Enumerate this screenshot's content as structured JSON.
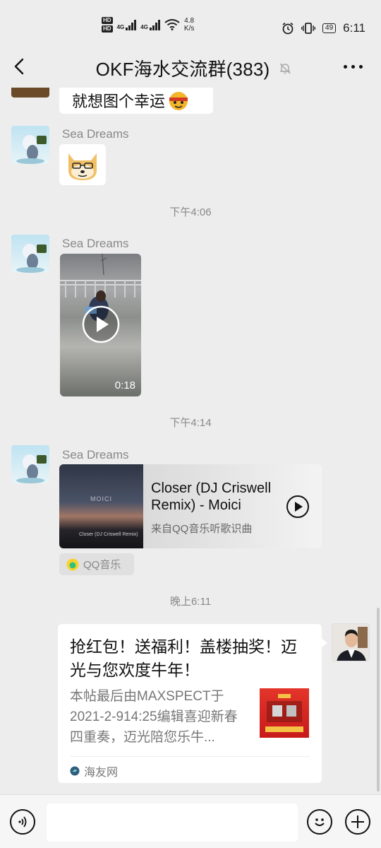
{
  "status_bar": {
    "hd1": "HD",
    "hd2": "HD",
    "net1": "4G",
    "net2": "4G",
    "speed_value": "4.8",
    "speed_unit": "K/s",
    "battery": "49",
    "time": "6:11"
  },
  "nav": {
    "title": "OKF海水交流群(383)"
  },
  "messages": {
    "partial_text": "就想图个幸运",
    "msg1": {
      "sender": "Sea Dreams"
    },
    "time1": "下午4:06",
    "msg2": {
      "sender": "Sea Dreams",
      "video_duration": "0:18"
    },
    "time2": "下午4:14",
    "msg3": {
      "sender": "Sea Dreams",
      "music_title": "Closer (DJ Criswell Remix) - Moici",
      "music_source": "来自QQ音乐听歌识曲",
      "cover_caption": "Closer (DJ Criswell Remix)",
      "cover_mark": "MOICI",
      "app_label": "QQ音乐"
    },
    "time3": "晚上6:11",
    "msg4": {
      "title": "抢红包！送福利！盖楼抽奖！迈光与您欢度牛年！",
      "desc": "本帖最后由MAXSPECT于2021-2-914:25编辑喜迎新春四重奏，迈光陪您乐牛...",
      "source": "海友网"
    }
  },
  "colors": {
    "background": "#ededed",
    "bubble": "#ffffff",
    "time_text": "#888888"
  }
}
